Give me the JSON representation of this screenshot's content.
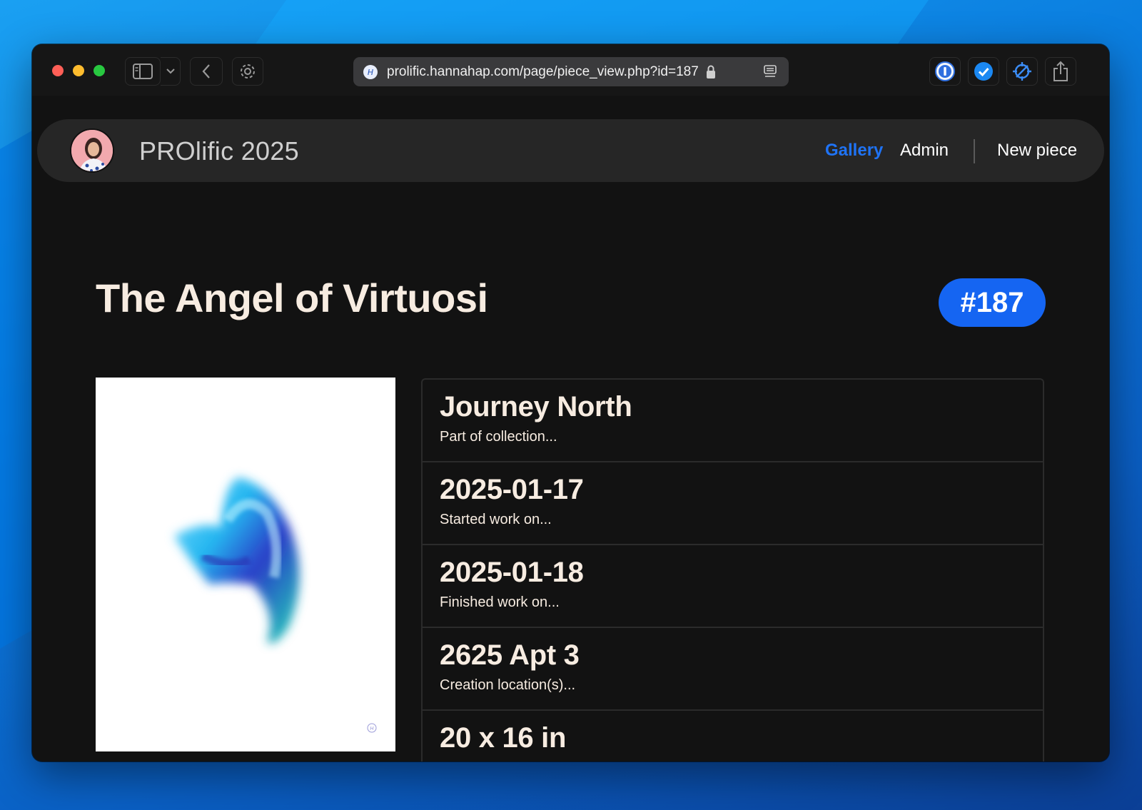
{
  "browser": {
    "url": "prolific.hannahap.com/page/piece_view.php?id=187"
  },
  "nav": {
    "brand": "PROlific 2025",
    "links": [
      "Gallery",
      "Admin",
      "New piece"
    ],
    "active_color": "#1f73f5"
  },
  "piece": {
    "title": "The Angel of Virtuosi",
    "number": "#187",
    "details": [
      {
        "value": "Journey North",
        "label": "Part of collection..."
      },
      {
        "value": "2025-01-17",
        "label": "Started work on..."
      },
      {
        "value": "2025-01-18",
        "label": "Finished work on..."
      },
      {
        "value": "2625 Apt 3",
        "label": "Creation location(s)..."
      },
      {
        "value": "20 x 16 in",
        "label": ""
      }
    ]
  },
  "colors": {
    "badge": "#1565f2",
    "text": "#f7ece1",
    "window_bg": "#121212"
  }
}
